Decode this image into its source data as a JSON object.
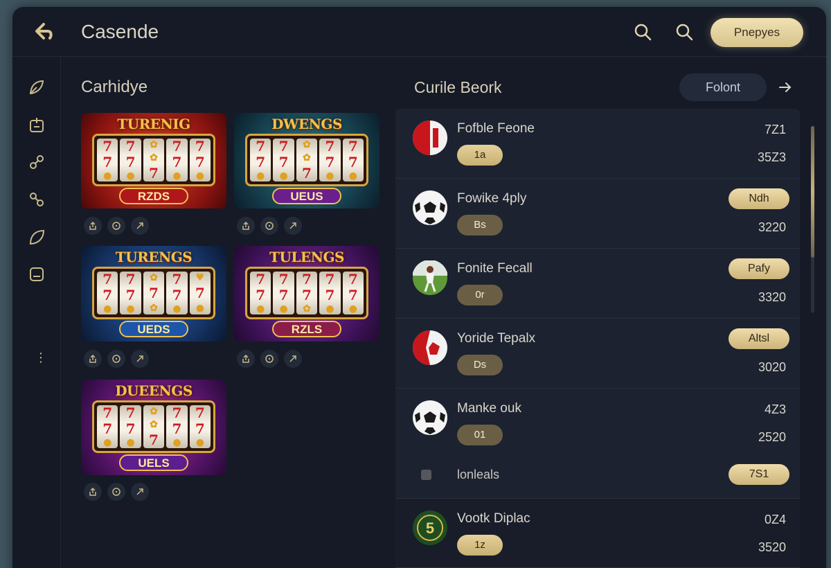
{
  "header": {
    "title": "Casende",
    "primary_button": "Pnepyes",
    "icons": [
      "search-icon",
      "search-icon"
    ]
  },
  "sidebar": {
    "icons": [
      "leaf-icon",
      "calendar-icon",
      "link-icon",
      "chain-icon",
      "feather-icon",
      "box-icon",
      "more-icon"
    ],
    "more": "⋮"
  },
  "games": {
    "title": "Carhidye",
    "cards": [
      {
        "banner": "TURENIG",
        "plate": "RZDS",
        "theme": "red"
      },
      {
        "banner": "DWENGS",
        "plate": "UEUS",
        "theme": "teal"
      },
      {
        "banner": "TURENGS",
        "plate": "UEDS",
        "theme": "blue"
      },
      {
        "banner": "TULENGS",
        "plate": "RZLS",
        "theme": "purple"
      },
      {
        "banner": "DUEENGS",
        "plate": "UELS",
        "theme": "violet"
      }
    ]
  },
  "list": {
    "title": "Curile Beork",
    "filter_button": "Folont",
    "rows": [
      {
        "name": "Fofble Feone",
        "pill": "1a",
        "pill_style": "gold",
        "tag": "",
        "v1": "7Z1",
        "v2": "35Z3",
        "avatar": "red-ball"
      },
      {
        "name": "Fowike 4ply",
        "pill": "Bs",
        "pill_style": "dark",
        "tag": "Ndh",
        "v1": "",
        "v2": "3220",
        "avatar": "soccer-ball"
      },
      {
        "name": "Fonite Fecall",
        "pill": "0r",
        "pill_style": "dark",
        "tag": "Pafy",
        "v1": "",
        "v2": "3320",
        "avatar": "player"
      },
      {
        "name": "Yoride Tepalx",
        "pill": "Ds",
        "pill_style": "dark",
        "tag": "Altsl",
        "v1": "",
        "v2": "3020",
        "avatar": "red-ball"
      },
      {
        "name": "Manke ouk",
        "pill": "01",
        "pill_style": "dark",
        "tag": "",
        "v1": "4Z3",
        "v2": "2520",
        "avatar": "soccer-ball"
      }
    ],
    "subrow": {
      "label": "lonleals",
      "tag": "7S1"
    },
    "last_row": {
      "name": "Vootk Diplac",
      "pill": "1z",
      "pill_style": "gold",
      "v1": "0Z4",
      "v2": "3520",
      "avatar": "green-badge",
      "badge_text": "5"
    }
  }
}
